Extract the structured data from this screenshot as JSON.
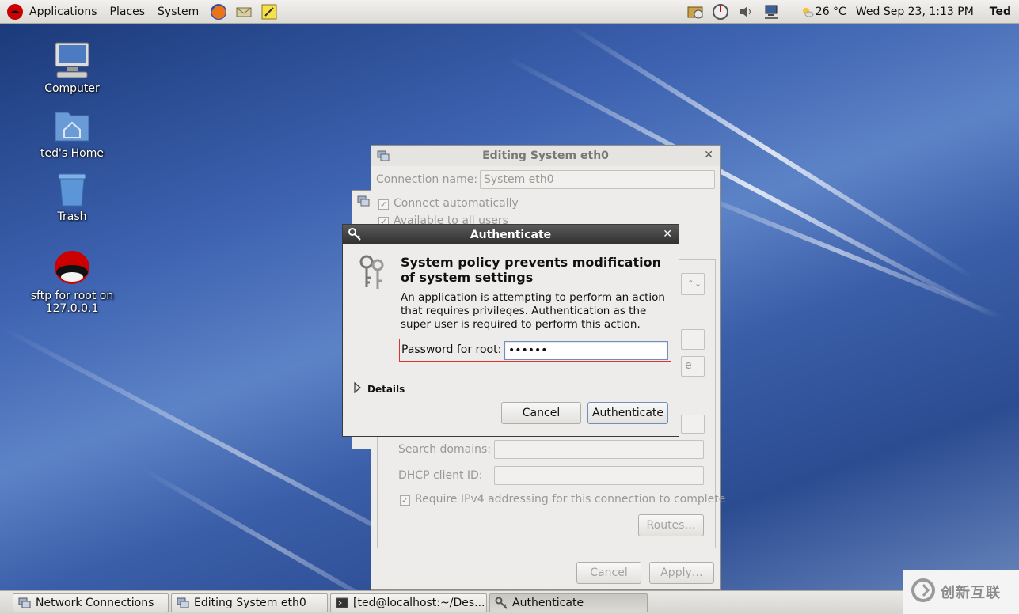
{
  "top_panel": {
    "menus": [
      "Applications",
      "Places",
      "System"
    ],
    "weather": "26 °C",
    "datetime": "Wed Sep 23,  1:13 PM",
    "user": "Ted"
  },
  "desktop_icons": [
    {
      "label": "Computer",
      "icon": "computer-icon"
    },
    {
      "label": "ted's Home",
      "icon": "home-folder-icon"
    },
    {
      "label": "Trash",
      "icon": "trash-icon"
    },
    {
      "label": "sftp for root on 127.0.0.1",
      "icon": "redhat-icon"
    }
  ],
  "editing_window": {
    "title": "Editing System eth0",
    "connection_name_label": "Connection name:",
    "connection_name_value": "System eth0",
    "connect_automatically": "Connect automatically",
    "available_to_all": "Available to all users",
    "search_domains_label": "Search domains:",
    "dhcp_client_id_label": "DHCP client ID:",
    "require_ipv4": "Require IPv4 addressing for this connection to complete",
    "routes_button": "Routes…",
    "cancel_button": "Cancel",
    "apply_button": "Apply…",
    "partial_button_text": "e"
  },
  "auth_dialog": {
    "title": "Authenticate",
    "heading": "System policy prevents modification of system settings",
    "body": "An application is attempting to perform an action that requires privileges. Authentication as the super user is required to perform this action.",
    "password_label": "Password for root:",
    "password_value": "••••••",
    "details_label": "Details",
    "cancel_button": "Cancel",
    "authenticate_button": "Authenticate"
  },
  "taskbar": [
    {
      "label": "Network Connections",
      "active": false
    },
    {
      "label": "Editing System eth0",
      "active": false
    },
    {
      "label": "[ted@localhost:~/Des...",
      "active": false
    },
    {
      "label": "Authenticate",
      "active": true
    }
  ],
  "watermark": "创新互联"
}
